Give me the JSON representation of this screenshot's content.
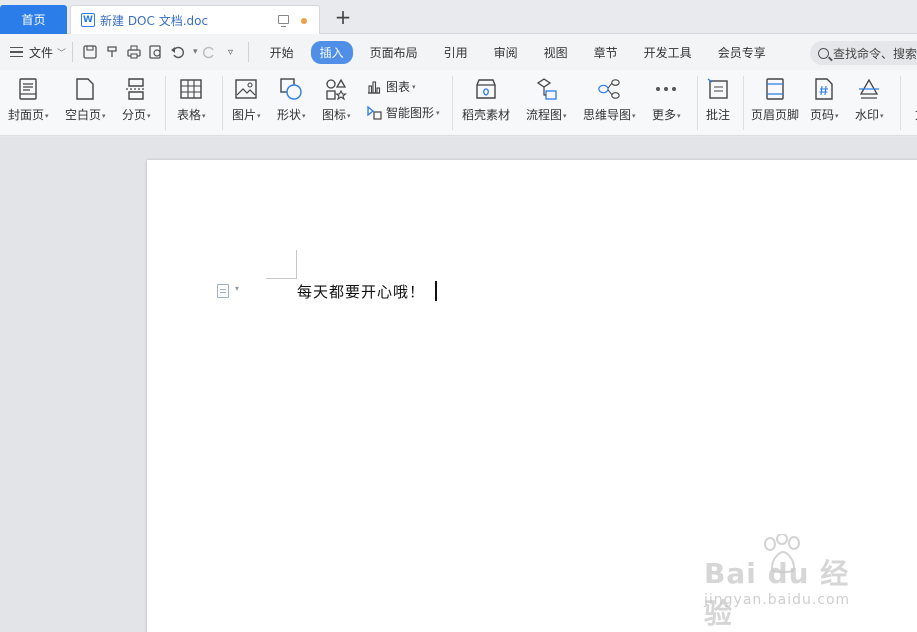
{
  "tabs": {
    "home_label": "首页",
    "doc_title": "新建 DOC 文档.doc",
    "doc_icon_letter": "W"
  },
  "menu": {
    "file_label": "文件",
    "tabs": [
      "开始",
      "插入",
      "页面布局",
      "引用",
      "审阅",
      "视图",
      "章节",
      "开发工具",
      "会员专享"
    ],
    "active_tab": "插入",
    "search_text": "查找命令、搜索"
  },
  "ribbon": {
    "cover": "封面页",
    "blank": "空白页",
    "pagebreak": "分页",
    "table": "表格",
    "picture": "图片",
    "shape": "形状",
    "iconlib": "图标",
    "chart": "图表",
    "smartart": "智能图形",
    "material": "稻壳素材",
    "flowchart": "流程图",
    "mindmap": "思维导图",
    "more": "更多",
    "comment": "批注",
    "headerfooter": "页眉页脚",
    "pagenum": "页码",
    "watermark": "水印",
    "cut_label": "文"
  },
  "document": {
    "body_text": "每天都要开心哦！"
  },
  "watermark": {
    "main": "Bai du 经验",
    "sub": "jingyan.baidu.com"
  },
  "colors": {
    "accent": "#2b7de9",
    "active_tab": "#4f8fe8",
    "unsaved_dot": "#f0a04b"
  }
}
